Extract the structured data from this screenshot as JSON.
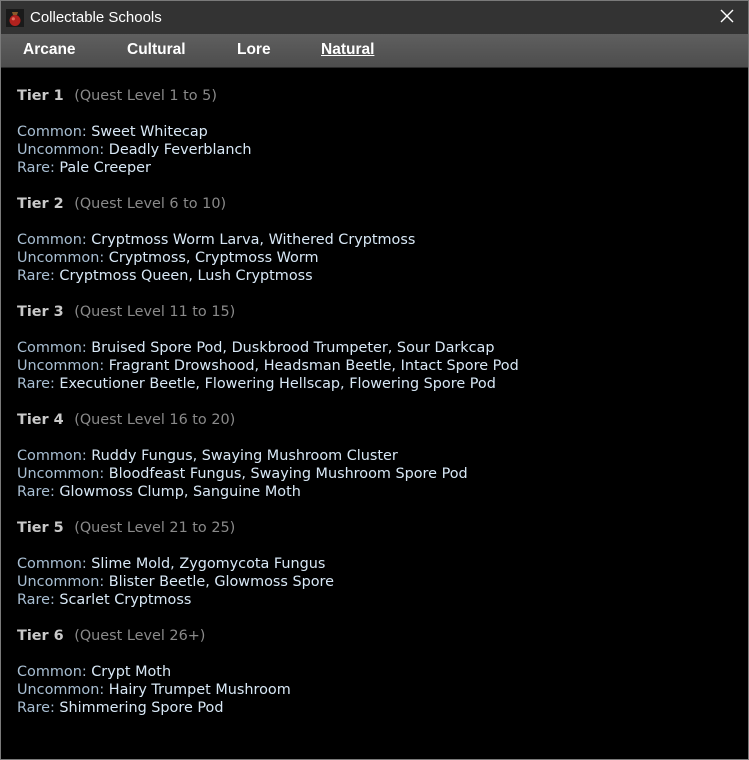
{
  "window": {
    "title": "Collectable Schools",
    "app_icon": "red-potion-bag-icon",
    "close_icon": "close-icon"
  },
  "tabs": [
    {
      "label": "Arcane",
      "active": false
    },
    {
      "label": "Cultural",
      "active": false
    },
    {
      "label": "Lore",
      "active": false
    },
    {
      "label": "Natural",
      "active": true
    }
  ],
  "tiers": [
    {
      "name": "Tier 1",
      "range": "(Quest Level 1 to 5)",
      "common_label": "Common:",
      "common": "Sweet Whitecap",
      "uncommon_label": "Uncommon:",
      "uncommon": "Deadly Feverblanch",
      "rare_label": "Rare:",
      "rare": "Pale Creeper"
    },
    {
      "name": "Tier 2",
      "range": "(Quest Level 6 to 10)",
      "common_label": "Common:",
      "common": "Cryptmoss Worm Larva, Withered Cryptmoss",
      "uncommon_label": "Uncommon:",
      "uncommon": "Cryptmoss, Cryptmoss Worm",
      "rare_label": "Rare:",
      "rare": "Cryptmoss Queen, Lush Cryptmoss"
    },
    {
      "name": "Tier 3",
      "range": "(Quest Level 11 to 15)",
      "common_label": "Common:",
      "common": "Bruised Spore Pod, Duskbrood Trumpeter, Sour Darkcap",
      "uncommon_label": "Uncommon:",
      "uncommon": "Fragrant Drowshood, Headsman Beetle, Intact Spore Pod",
      "rare_label": "Rare:",
      "rare": "Executioner Beetle, Flowering Hellscap, Flowering Spore Pod"
    },
    {
      "name": "Tier 4",
      "range": "(Quest Level 16 to 20)",
      "common_label": "Common:",
      "common": "Ruddy Fungus, Swaying Mushroom Cluster",
      "uncommon_label": "Uncommon:",
      "uncommon": "Bloodfeast Fungus, Swaying Mushroom Spore Pod",
      "rare_label": "Rare:",
      "rare": "Glowmoss Clump, Sanguine Moth"
    },
    {
      "name": "Tier 5",
      "range": "(Quest Level 21 to 25)",
      "common_label": "Common:",
      "common": "Slime Mold, Zygomycota Fungus",
      "uncommon_label": "Uncommon:",
      "uncommon": "Blister Beetle, Glowmoss Spore",
      "rare_label": "Rare:",
      "rare": "Scarlet Cryptmoss"
    },
    {
      "name": "Tier 6",
      "range": "(Quest Level 26+)",
      "common_label": "Common:",
      "common": "Crypt Moth",
      "uncommon_label": "Uncommon:",
      "uncommon": "Hairy Trumpet Mushroom",
      "rare_label": "Rare:",
      "rare": "Shimmering Spore Pod"
    }
  ]
}
